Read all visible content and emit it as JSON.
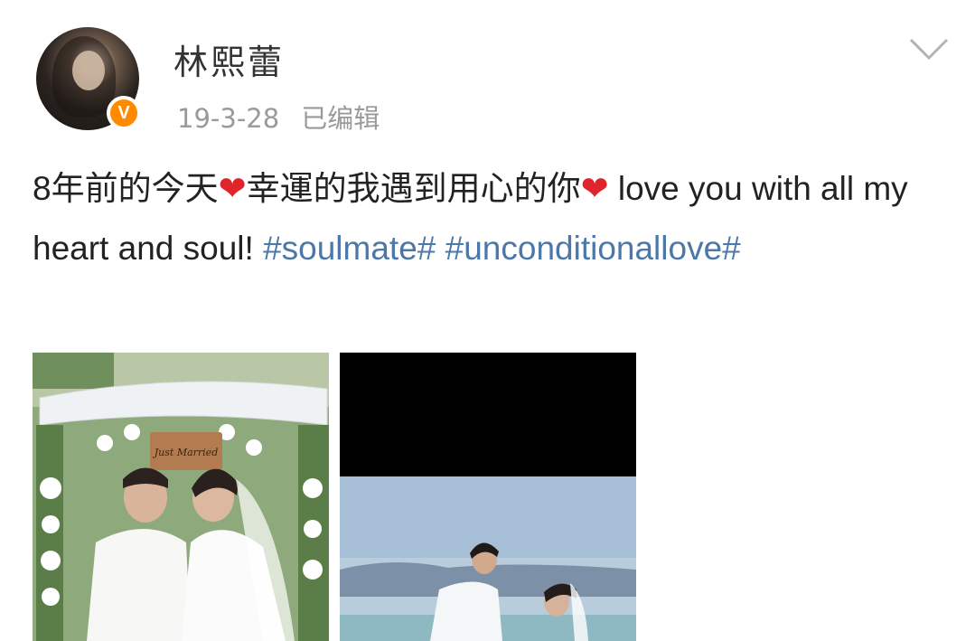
{
  "post": {
    "author": "林熙蕾",
    "date": "19-3-28",
    "edited_label": "已编辑",
    "verified_badge": "V",
    "text_segments": [
      {
        "type": "text",
        "value": "8年前的今天"
      },
      {
        "type": "icon",
        "value": "❤"
      },
      {
        "type": "text",
        "value": "幸運的我遇到用心的你"
      },
      {
        "type": "icon",
        "value": "❤"
      },
      {
        "type": "text",
        "value": " love you with all my heart and soul! "
      },
      {
        "type": "hashtag",
        "value": "#soulmate#"
      },
      {
        "type": "text",
        "value": " "
      },
      {
        "type": "hashtag",
        "value": "#unconditionallove#"
      }
    ],
    "photos": [
      {
        "sign_text": "Just Married"
      },
      {}
    ]
  },
  "colors": {
    "hashtag": "#4b78a8",
    "verified": "#ff8a00",
    "heart": "#e0242c",
    "meta_text": "#9a9a9a"
  },
  "icons": {
    "dropdown": "chevron-down-icon",
    "verified": "verified-badge-icon",
    "heart": "heart-icon"
  }
}
